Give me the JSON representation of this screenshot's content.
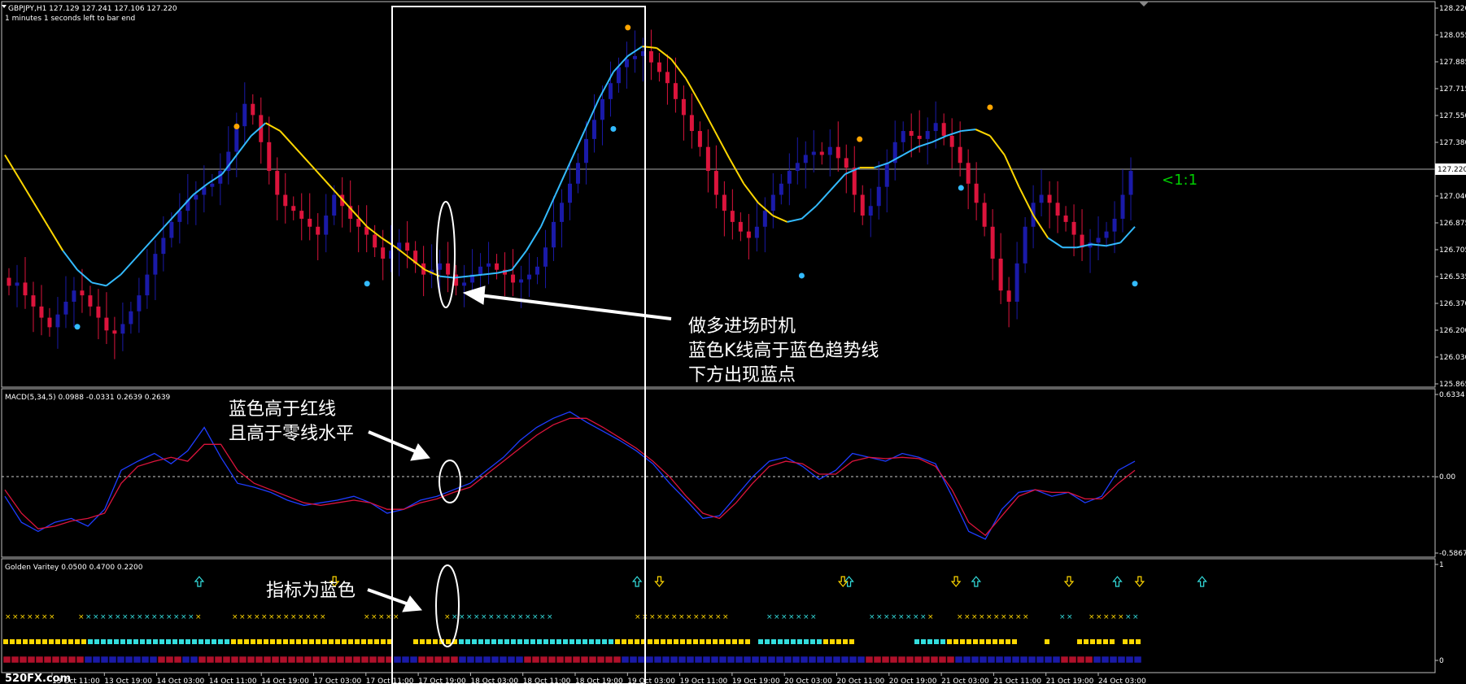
{
  "window": {
    "symbol_line": "GBPJPY,H1  127.129 127.241 127.106 127.220",
    "timer": "1 minutes 1 seconds left to bar end",
    "macd_line": "MACD(5,34,5) 0.0988 -0.0331 0.2639 0.2639",
    "golden_line": "Golden Varitey 0.0500 0.4700 0.2200",
    "ratio_label": "<1:1",
    "watermark": "520FX.com"
  },
  "colors": {
    "background": "#000000",
    "bull_candle": "#1a1aa8",
    "bear_candle": "#dc143c",
    "trend_up": "#33bbff",
    "trend_down": "#ffd700",
    "dot_buy": "#33bbff",
    "dot_sell": "#ffa500",
    "macd_main": "#1e3cff",
    "macd_signal": "#dc143c",
    "signal_cyan": "#33dddd",
    "signal_yellow": "#ffd700",
    "ratio_green": "#00cc00"
  },
  "annotations": {
    "main": [
      "做多进场时机",
      "蓝色K线高于蓝色趋势线",
      "下方出现蓝点"
    ],
    "macd": [
      "蓝色高于红线",
      "且高于零线水平"
    ],
    "indicator": [
      "指标为蓝色"
    ]
  },
  "chart_data": [
    {
      "type": "candlestick",
      "title": "GBPJPY,H1",
      "ylim": [
        125.865,
        128.22
      ],
      "y_ticks": [
        "128.220",
        "128.055",
        "127.885",
        "127.715",
        "127.550",
        "127.380",
        "127.220",
        "127.040",
        "126.875",
        "126.705",
        "126.535",
        "126.370",
        "126.200",
        "126.030",
        "125.865"
      ],
      "current_price": "127.220",
      "close": [
        126.48,
        126.5,
        126.42,
        126.35,
        126.28,
        126.22,
        126.3,
        126.38,
        126.45,
        126.42,
        126.35,
        126.28,
        126.2,
        126.18,
        126.24,
        126.32,
        126.42,
        126.55,
        126.68,
        126.78,
        126.88,
        126.95,
        127.02,
        127.05,
        127.1,
        127.12,
        127.2,
        127.32,
        127.48,
        127.62,
        127.55,
        127.38,
        127.2,
        127.05,
        126.98,
        126.95,
        126.9,
        126.85,
        126.8,
        126.92,
        127.05,
        126.98,
        126.9,
        126.85,
        126.8,
        126.72,
        126.65,
        126.7,
        126.75,
        126.7,
        126.62,
        126.55,
        126.58,
        126.62,
        126.55,
        126.48,
        126.5,
        126.55,
        126.6,
        126.62,
        126.58,
        126.55,
        126.5,
        126.52,
        126.55,
        126.6,
        126.72,
        126.88,
        127.0,
        127.12,
        127.25,
        127.4,
        127.52,
        127.65,
        127.75,
        127.85,
        127.9,
        127.92,
        127.95,
        127.88,
        127.82,
        127.75,
        127.65,
        127.55,
        127.45,
        127.35,
        127.2,
        127.05,
        126.95,
        126.88,
        126.82,
        126.78,
        126.85,
        126.95,
        127.05,
        127.12,
        127.2,
        127.25,
        127.3,
        127.32,
        127.3,
        127.35,
        127.28,
        127.22,
        127.05,
        126.92,
        126.98,
        127.1,
        127.25,
        127.38,
        127.45,
        127.42,
        127.4,
        127.45,
        127.5,
        127.42,
        127.35,
        127.25,
        127.12,
        127.0,
        126.85,
        126.65,
        126.45,
        126.38,
        126.62,
        126.85,
        127.0,
        127.05,
        127.0,
        126.92,
        126.88,
        126.8,
        126.72,
        126.75,
        126.78,
        126.82,
        126.9,
        127.05,
        127.2
      ],
      "trend_line": [
        127.3,
        127.15,
        127.0,
        126.85,
        126.7,
        126.58,
        126.5,
        126.48,
        126.55,
        126.65,
        126.75,
        126.85,
        126.95,
        127.05,
        127.12,
        127.18,
        127.3,
        127.42,
        127.5,
        127.45,
        127.35,
        127.25,
        127.15,
        127.05,
        126.95,
        126.85,
        126.78,
        126.72,
        126.65,
        126.58,
        126.54,
        126.53,
        126.54,
        126.55,
        126.56,
        126.58,
        126.7,
        126.85,
        127.05,
        127.25,
        127.45,
        127.65,
        127.82,
        127.92,
        127.98,
        127.97,
        127.9,
        127.78,
        127.62,
        127.45,
        127.28,
        127.12,
        127.0,
        126.92,
        126.88,
        126.9,
        126.98,
        127.08,
        127.18,
        127.22,
        127.22,
        127.25,
        127.3,
        127.35,
        127.38,
        127.42,
        127.45,
        127.46,
        127.42,
        127.3,
        127.1,
        126.92,
        126.78,
        126.72,
        126.72,
        126.74,
        126.73,
        126.75,
        126.85
      ],
      "trend_colors": [
        "down",
        "down",
        "down",
        "down",
        "down",
        "up",
        "up",
        "up",
        "up",
        "up",
        "up",
        "up",
        "up",
        "up",
        "up",
        "up",
        "up",
        "up",
        "up",
        "down",
        "down",
        "down",
        "down",
        "down",
        "down",
        "down",
        "down",
        "down",
        "down",
        "down",
        "down",
        "up",
        "up",
        "up",
        "up",
        "up",
        "up",
        "up",
        "up",
        "up",
        "up",
        "up",
        "up",
        "up",
        "up",
        "down",
        "down",
        "down",
        "down",
        "down",
        "down",
        "down",
        "down",
        "down",
        "down",
        "up",
        "up",
        "up",
        "up",
        "up",
        "down",
        "up",
        "up",
        "up",
        "up",
        "up",
        "up",
        "up",
        "down",
        "down",
        "down",
        "down",
        "down",
        "up",
        "up",
        "up",
        "up",
        "up",
        "up"
      ],
      "buy_dots": [
        5,
        25,
        42,
        55,
        66,
        78
      ],
      "sell_dots": [
        16,
        43,
        59,
        68
      ]
    },
    {
      "type": "line",
      "title": "MACD(5,34,5)",
      "ylim": [
        -0.5867,
        0.6334
      ],
      "y_ticks": [
        "0.6334",
        "0.00",
        "-0.5867"
      ],
      "series": [
        {
          "name": "MACD",
          "values": [
            -0.15,
            -0.35,
            -0.42,
            -0.35,
            -0.32,
            -0.38,
            -0.25,
            0.05,
            0.12,
            0.18,
            0.1,
            0.2,
            0.38,
            0.15,
            -0.05,
            -0.08,
            -0.12,
            -0.18,
            -0.22,
            -0.2,
            -0.18,
            -0.15,
            -0.2,
            -0.28,
            -0.25,
            -0.18,
            -0.15,
            -0.1,
            -0.05,
            0.05,
            0.15,
            0.28,
            0.38,
            0.45,
            0.5,
            0.42,
            0.35,
            0.28,
            0.2,
            0.1,
            -0.05,
            -0.18,
            -0.32,
            -0.3,
            -0.15,
            0.0,
            0.12,
            0.15,
            0.08,
            -0.02,
            0.05,
            0.18,
            0.15,
            0.12,
            0.18,
            0.15,
            0.1,
            -0.15,
            -0.42,
            -0.48,
            -0.25,
            -0.12,
            -0.1,
            -0.15,
            -0.12,
            -0.2,
            -0.15,
            0.05,
            0.12
          ]
        },
        {
          "name": "Signal",
          "values": [
            -0.1,
            -0.28,
            -0.4,
            -0.38,
            -0.34,
            -0.32,
            -0.28,
            -0.05,
            0.08,
            0.12,
            0.15,
            0.12,
            0.25,
            0.25,
            0.05,
            -0.05,
            -0.1,
            -0.15,
            -0.2,
            -0.22,
            -0.2,
            -0.18,
            -0.2,
            -0.25,
            -0.25,
            -0.2,
            -0.17,
            -0.12,
            -0.08,
            0.02,
            0.12,
            0.22,
            0.32,
            0.4,
            0.45,
            0.45,
            0.38,
            0.3,
            0.22,
            0.12,
            0.0,
            -0.15,
            -0.28,
            -0.32,
            -0.2,
            -0.05,
            0.08,
            0.12,
            0.1,
            0.02,
            0.02,
            0.12,
            0.15,
            0.14,
            0.15,
            0.14,
            0.08,
            -0.1,
            -0.35,
            -0.45,
            -0.3,
            -0.15,
            -0.1,
            -0.12,
            -0.12,
            -0.17,
            -0.17,
            -0.05,
            0.05
          ]
        }
      ]
    },
    {
      "type": "signal",
      "title": "Golden Varitey",
      "ylim": [
        0,
        1
      ],
      "y_ticks": [
        "1",
        "0"
      ],
      "up_arrows": [
        8,
        39,
        54,
        63,
        73,
        79
      ],
      "down_arrows": [
        17,
        40,
        53,
        61,
        69,
        74
      ],
      "x_labels": [
        "13 Oct 11:00",
        "13 Oct 19:00",
        "14 Oct 03:00",
        "14 Oct 11:00",
        "14 Oct 19:00",
        "17 Oct 03:00",
        "17 Oct 11:00",
        "17 Oct 19:00",
        "18 Oct 03:00",
        "18 Oct 11:00",
        "18 Oct 19:00",
        "19 Oct 03:00",
        "19 Oct 11:00",
        "19 Oct 19:00",
        "20 Oct 03:00",
        "20 Oct 11:00",
        "20 Oct 19:00",
        "21 Oct 03:00",
        "21 Oct 11:00",
        "21 Oct 19:00",
        "24 Oct 03:00"
      ]
    }
  ]
}
